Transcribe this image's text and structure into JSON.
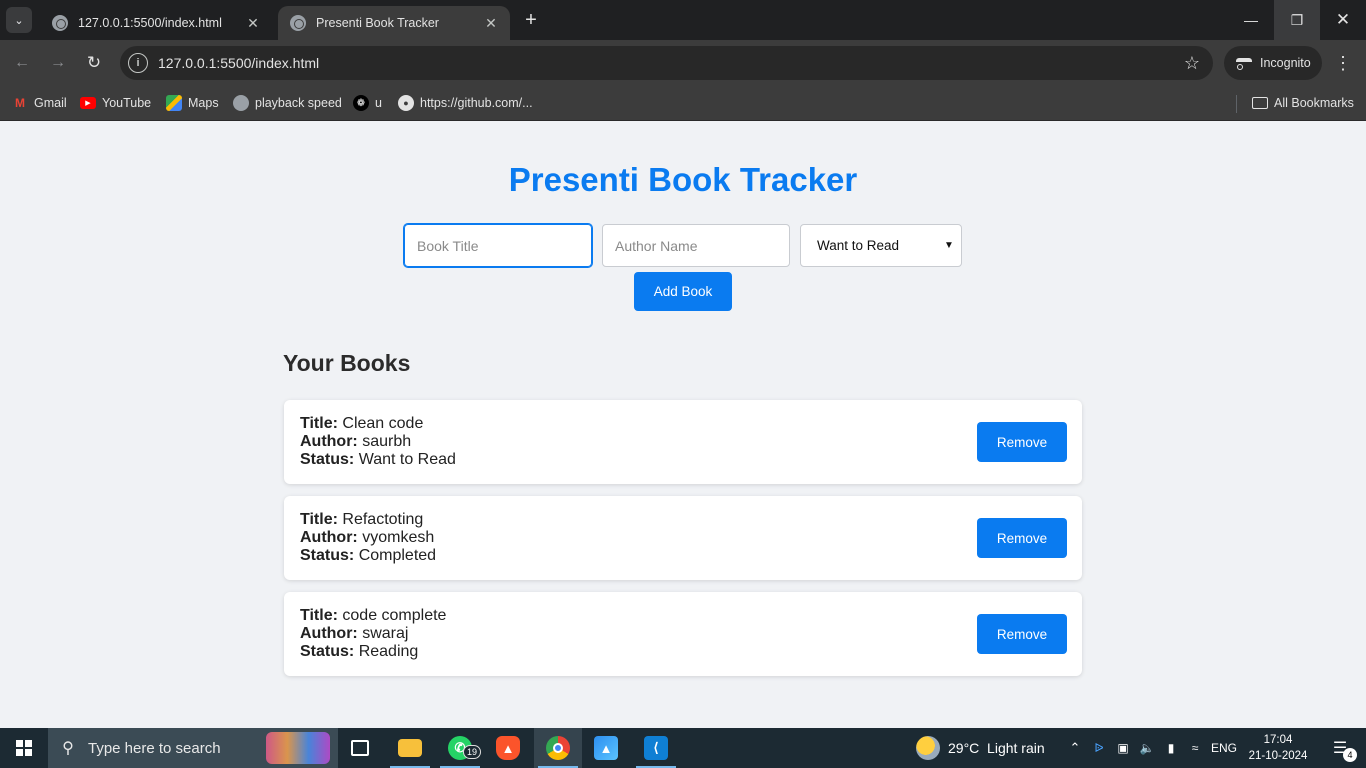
{
  "browser": {
    "tabs": [
      {
        "title": "127.0.0.1:5500/index.html"
      },
      {
        "title": "Presenti Book Tracker"
      }
    ],
    "url": "127.0.0.1:5500/index.html",
    "incognito_label": "Incognito",
    "bookmarks": [
      {
        "label": "Gmail"
      },
      {
        "label": "YouTube"
      },
      {
        "label": "Maps"
      },
      {
        "label": "playback speed"
      },
      {
        "label": "u"
      },
      {
        "label": "https://github.com/..."
      }
    ],
    "all_bookmarks": "All Bookmarks"
  },
  "app": {
    "title": "Presenti Book Tracker",
    "form": {
      "title_placeholder": "Book Title",
      "author_placeholder": "Author Name",
      "status_selected": "Want to Read",
      "add_label": "Add Book"
    },
    "section_title": "Your Books",
    "labels": {
      "title": "Title:",
      "author": "Author:",
      "status": "Status:"
    },
    "remove_label": "Remove",
    "books": [
      {
        "title": "Clean code",
        "author": "saurbh",
        "status": "Want to Read"
      },
      {
        "title": "Refactoting",
        "author": "vyomkesh",
        "status": "Completed"
      },
      {
        "title": "code complete",
        "author": "swaraj",
        "status": "Reading"
      }
    ]
  },
  "taskbar": {
    "search_placeholder": "Type here to search",
    "whatsapp_badge": "19",
    "weather": "29°C  Light rain",
    "language": "ENG",
    "time": "17:04",
    "date": "21-10-2024",
    "notification_count": "4"
  },
  "colors": {
    "accent": "#0a7bf0",
    "page_bg": "#f0f2f5"
  }
}
